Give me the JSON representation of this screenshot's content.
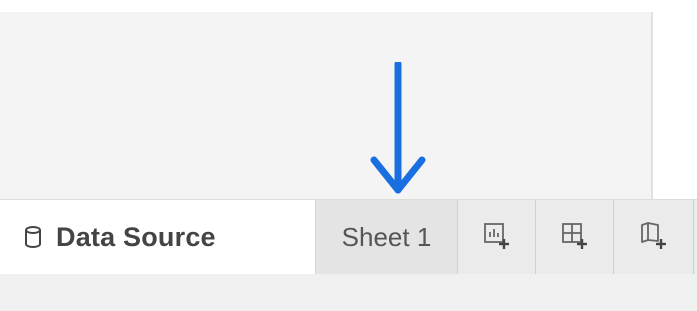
{
  "tabs": {
    "data_source": {
      "label": "Data Source",
      "icon": "database-icon"
    },
    "sheet": {
      "label": "Sheet 1"
    },
    "actions": [
      {
        "icon": "new-worksheet-icon"
      },
      {
        "icon": "new-dashboard-icon"
      },
      {
        "icon": "new-story-icon"
      }
    ]
  },
  "annotation": {
    "arrow_color": "#1a6fe0",
    "points_to": "Sheet 1"
  },
  "colors": {
    "canvas": "#f4f4f4",
    "tab_bar": "#ececec",
    "active_tab": "#ffffff",
    "label_text": "#444444",
    "icon_stroke": "#666666"
  }
}
